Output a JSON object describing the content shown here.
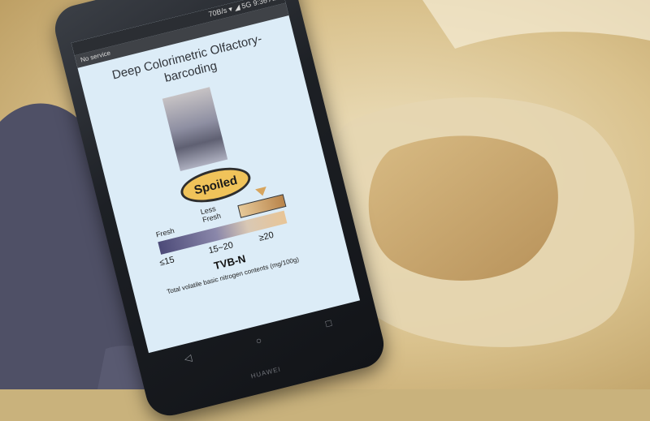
{
  "status_bar": {
    "text": "70B/s  ▾  ◢ 5G  9:36 AM"
  },
  "app_bar": {
    "no_service": "No service"
  },
  "app": {
    "title": "Deep Colorimetric Olfactory-barcoding",
    "result_badge": "Spoiled",
    "labels": {
      "fresh": "Fresh",
      "less_fresh": "Less Fresh"
    },
    "ticks": [
      "≤15",
      "15~20",
      "≥20"
    ],
    "metric": "TVB-N",
    "caption": "Total volatile basic nitrogen contents (mg/100g)"
  },
  "brand": "HUAWEI",
  "icons": [
    "back-icon",
    "home-icon",
    "recents-icon"
  ],
  "colors": {
    "badge": "#f0c35a",
    "screen_bg": "#dcecf7",
    "glove": "#4f5066",
    "background": "#c9b27c"
  }
}
